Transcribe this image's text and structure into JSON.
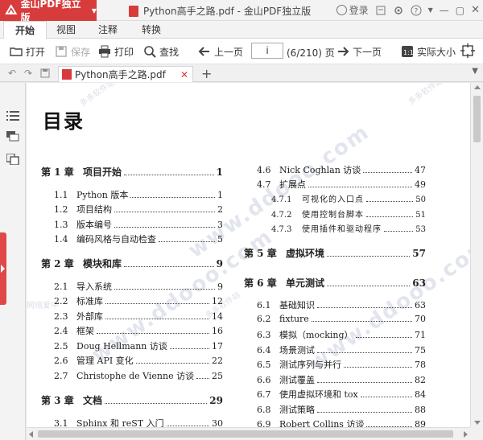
{
  "app": {
    "name": "金山PDF独立版",
    "doc_title": "Python高手之路.pdf - 金山PDF独立版",
    "login": "登录"
  },
  "menu": {
    "tabs": [
      "开始",
      "视图",
      "注释",
      "转换"
    ]
  },
  "toolbar": {
    "open": "打开",
    "save": "保存",
    "print": "打印",
    "find": "查找",
    "prev_page": "上一页",
    "page_input": "i",
    "page_count": "(6/210) 页",
    "next_page": "下一页",
    "actual_size": "实际大小"
  },
  "doc_tab": {
    "name": "Python高手之路.pdf"
  },
  "toc": {
    "heading": "目录",
    "left": [
      {
        "level": "chap",
        "num": "第 1 章",
        "text": "项目开始",
        "page": "1"
      },
      {
        "level": "sec",
        "num": "1.1",
        "text": "Python 版本",
        "page": "1"
      },
      {
        "level": "sec",
        "num": "1.2",
        "text": "项目结构",
        "page": "2"
      },
      {
        "level": "sec",
        "num": "1.3",
        "text": "版本编号",
        "page": "3"
      },
      {
        "level": "sec",
        "num": "1.4",
        "text": "编码风格与自动检查",
        "page": "5"
      },
      {
        "level": "chap",
        "num": "第 2 章",
        "text": "模块和库",
        "page": "9"
      },
      {
        "level": "sec",
        "num": "2.1",
        "text": "导入系统",
        "page": "9"
      },
      {
        "level": "sec",
        "num": "2.2",
        "text": "标准库",
        "page": "12"
      },
      {
        "level": "sec",
        "num": "2.3",
        "text": "外部库",
        "page": "14"
      },
      {
        "level": "sec",
        "num": "2.4",
        "text": "框架",
        "page": "16"
      },
      {
        "level": "sec",
        "num": "2.5",
        "text": "Doug Hellmann 访谈",
        "page": "17"
      },
      {
        "level": "sec",
        "num": "2.6",
        "text": "管理 API 变化",
        "page": "22"
      },
      {
        "level": "sec",
        "num": "2.7",
        "text": "Christophe de Vienne 访谈",
        "page": "25"
      },
      {
        "level": "chap",
        "num": "第 3 章",
        "text": "文档",
        "page": "29"
      },
      {
        "level": "sec",
        "num": "3.1",
        "text": "Sphinx 和 reST 入门",
        "page": "30"
      }
    ],
    "right": [
      {
        "level": "sec",
        "num": "4.6",
        "text": "Nick Coghlan 访谈",
        "page": "47"
      },
      {
        "level": "sec",
        "num": "4.7",
        "text": "扩展点",
        "page": "49"
      },
      {
        "level": "sub",
        "num": "4.7.1",
        "text": "可视化的入口点",
        "page": "50"
      },
      {
        "level": "sub",
        "num": "4.7.2",
        "text": "使用控制台脚本",
        "page": "51"
      },
      {
        "level": "sub",
        "num": "4.7.3",
        "text": "使用插件和驱动程序",
        "page": "53"
      },
      {
        "level": "chap",
        "num": "第 5 章",
        "text": "虚拟环境",
        "page": "57"
      },
      {
        "level": "chap",
        "num": "第 6 章",
        "text": "单元测试",
        "page": "63"
      },
      {
        "level": "sec",
        "num": "6.1",
        "text": "基础知识",
        "page": "63"
      },
      {
        "level": "sec",
        "num": "6.2",
        "text": "fixture",
        "page": "70"
      },
      {
        "level": "sec",
        "num": "6.3",
        "text": "模拟（mocking）",
        "page": "71"
      },
      {
        "level": "sec",
        "num": "6.4",
        "text": "场景测试",
        "page": "75"
      },
      {
        "level": "sec",
        "num": "6.5",
        "text": "测试序列与并行",
        "page": "78"
      },
      {
        "level": "sec",
        "num": "6.6",
        "text": "测试覆盖",
        "page": "82"
      },
      {
        "level": "sec",
        "num": "6.7",
        "text": "使用虚拟环境和 tox",
        "page": "84"
      },
      {
        "level": "sec",
        "num": "6.8",
        "text": "测试策略",
        "page": "88"
      },
      {
        "level": "sec",
        "num": "6.9",
        "text": "Robert Collins 访谈",
        "page": "89"
      }
    ]
  },
  "watermark": {
    "text": "www.ddooo.com",
    "side_text": "多多软件站",
    "side_note": "网络爱中"
  },
  "colors": {
    "brand": "#d83b3b"
  }
}
